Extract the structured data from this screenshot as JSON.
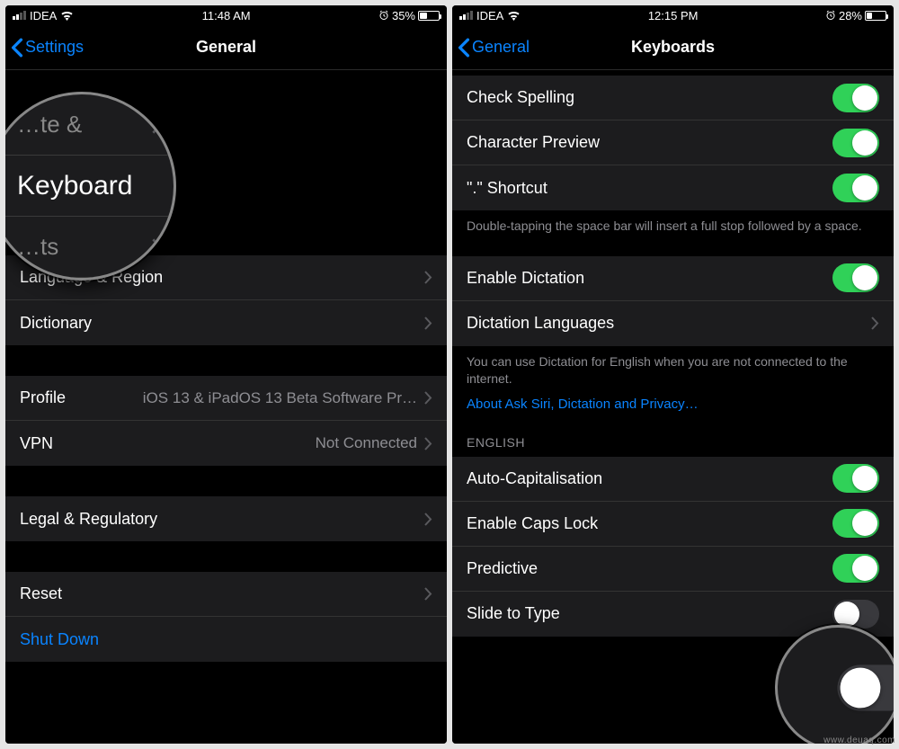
{
  "left": {
    "status": {
      "carrier": "IDEA",
      "time": "11:48 AM",
      "battery_pct": "35%",
      "battery_fill": 35
    },
    "nav": {
      "back": "Settings",
      "title": "General"
    },
    "zoom": {
      "above": "…te &",
      "focus": "Keyboard",
      "below": "…ts"
    },
    "rows": {
      "lang": "Language & Region",
      "dict": "Dictionary",
      "profile_label": "Profile",
      "profile_value": "iOS 13 & iPadOS 13 Beta Software Pr…",
      "vpn_label": "VPN",
      "vpn_value": "Not Connected",
      "legal": "Legal & Regulatory",
      "reset": "Reset",
      "shutdown": "Shut Down"
    }
  },
  "right": {
    "status": {
      "carrier": "IDEA",
      "time": "12:15 PM",
      "battery_pct": "28%",
      "battery_fill": 28
    },
    "nav": {
      "back": "General",
      "title": "Keyboards"
    },
    "toggles": {
      "check_spelling": "Check Spelling",
      "char_preview": "Character Preview",
      "shortcut": "\".\" Shortcut",
      "enable_dictation": "Enable Dictation",
      "auto_cap": "Auto-Capitalisation",
      "caps_lock": "Enable Caps Lock",
      "predictive": "Predictive",
      "slide": "Slide to Type"
    },
    "rows": {
      "dict_lang": "Dictation Languages"
    },
    "footers": {
      "shortcut": "Double-tapping the space bar will insert a full stop followed by a space.",
      "dictation": "You can use Dictation for English when you are not connected to the internet.",
      "siri_link": "About Ask Siri, Dictation and Privacy…"
    },
    "section": {
      "english": "ENGLISH"
    }
  },
  "watermark": "www.deuaq.com"
}
